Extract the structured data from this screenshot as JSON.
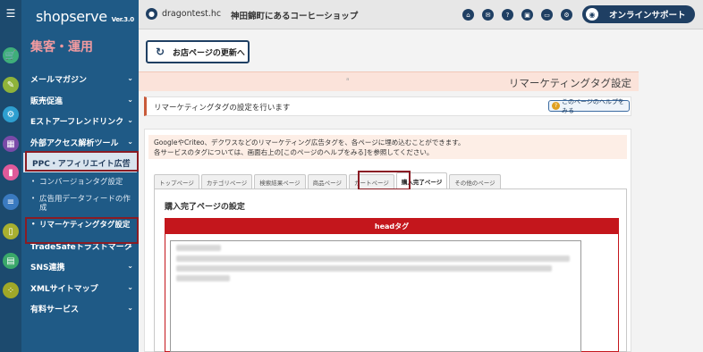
{
  "brand": {
    "name": "shopserve",
    "version": "Ver.3.0"
  },
  "section_title": "集客・運用",
  "menu": [
    {
      "label": "メールマガジン"
    },
    {
      "label": "販売促進"
    },
    {
      "label": "Eストアーフレンドリンク"
    },
    {
      "label": "外部アクセス解析ツール"
    },
    {
      "label": "PPC・アフィリエイト広告"
    },
    {
      "label": "TradeSafeトラストマーク"
    },
    {
      "label": "SNS連携"
    },
    {
      "label": "XMLサイトマップ"
    },
    {
      "label": "有料サービス"
    }
  ],
  "submenu": [
    {
      "label": "コンバージョンタグ設定"
    },
    {
      "label": "広告用データフィードの作成"
    },
    {
      "label": "リマーケティングタグ設定"
    }
  ],
  "topbar": {
    "username": "dragontest.hc",
    "shop_name": "神田錦町にあるコーヒーショップ",
    "support_label": "オンラインサポート"
  },
  "refresh_label": "お店ページの更新へ",
  "page_title": "リマーケティングタグ設定",
  "intro_text": "リマーケティングタグの設定を行います",
  "help_label": "このページのヘルプをみる",
  "notice": {
    "line1": "GoogleやCriteo、デクワスなどのリマーケティング広告タグを、各ページに埋め込むことができます。",
    "line2": "各サービスのタグについては、画面右上の[このページのヘルプをみる]を参照してください。"
  },
  "tabs": [
    {
      "label": "トップページ"
    },
    {
      "label": "カテゴリページ"
    },
    {
      "label": "検索結果ページ"
    },
    {
      "label": "商品ページ"
    },
    {
      "label": "カートページ"
    },
    {
      "label": "購入完了ページ"
    },
    {
      "label": "その他のページ"
    }
  ],
  "content": {
    "section_title": "購入完了ページの設定",
    "head_label": "headタグ"
  },
  "colors": {
    "sidebar": "#1f5a86",
    "rail": "#1c4a6e",
    "accent_red": "#c4161c",
    "highlight": "#8a1c24",
    "navy": "#1f3f63"
  }
}
